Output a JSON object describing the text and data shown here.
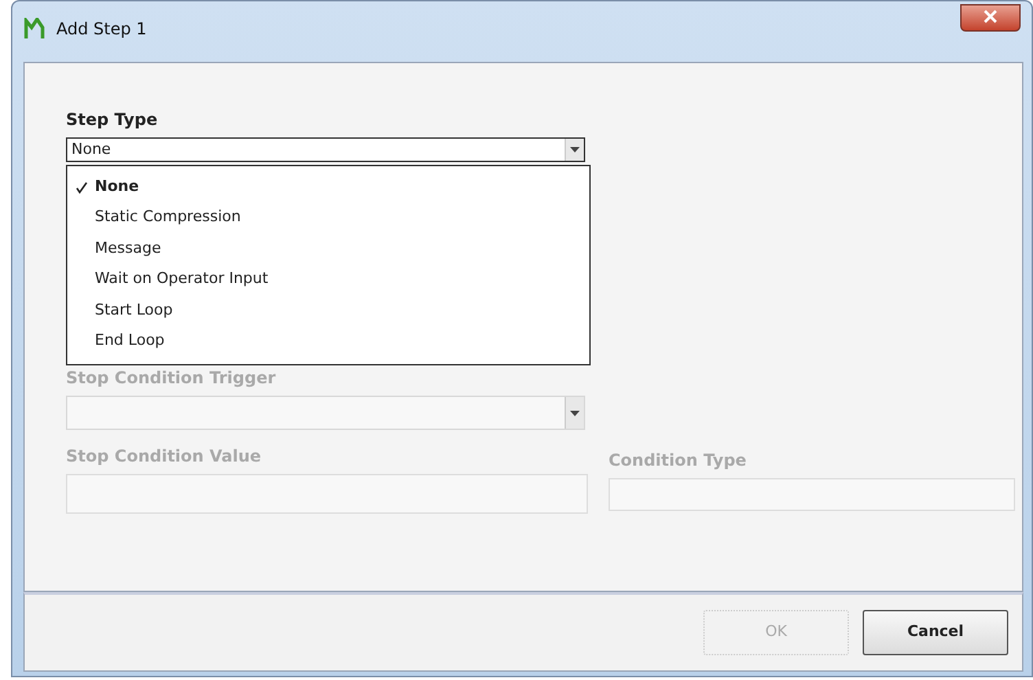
{
  "window": {
    "title": "Add Step 1"
  },
  "step_type": {
    "label": "Step Type",
    "value": "None",
    "expanded": true,
    "options": [
      {
        "label": "None",
        "selected": true
      },
      {
        "label": "Static Compression",
        "selected": false
      },
      {
        "label": "Message",
        "selected": false
      },
      {
        "label": "Wait on Operator Input",
        "selected": false
      },
      {
        "label": "Start Loop",
        "selected": false
      },
      {
        "label": "End Loop",
        "selected": false
      }
    ]
  },
  "stop_condition_trigger": {
    "label": "Stop Condition Trigger",
    "disabled": true
  },
  "stop_condition_value": {
    "label": "Stop Condition Value",
    "disabled": true
  },
  "condition_type": {
    "label": "Condition Type",
    "disabled": true
  },
  "buttons": [
    {
      "label": "OK",
      "disabled": true
    },
    {
      "label": "Cancel",
      "disabled": false
    }
  ]
}
